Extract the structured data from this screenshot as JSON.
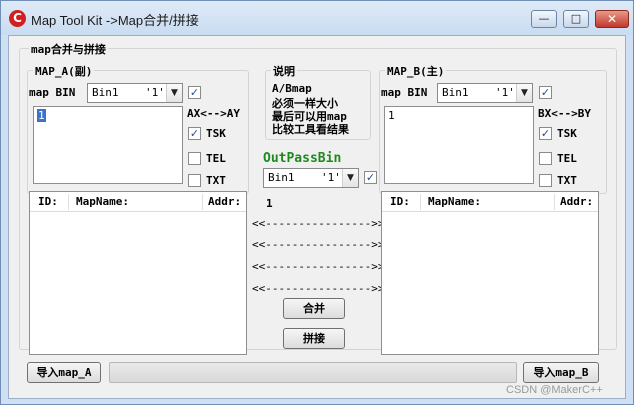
{
  "window": {
    "title": "Map Tool Kit ->Map合并/拼接",
    "app_icon": "C",
    "min_label": "—",
    "max_label": "□",
    "close_label": "✕"
  },
  "main_group": {
    "label": "map合并与拼接"
  },
  "panel_a": {
    "label": "MAP_A(副)",
    "bin_label": "map BIN",
    "combo_value": "Bin1    '1'",
    "input_value": "1",
    "axis_label": "AX<-->AY",
    "tsk_label": "TSK",
    "tel_label": "TEL",
    "txt_label": "TXT",
    "columns": [
      "ID:",
      "MapName:",
      "Addr:"
    ],
    "import_button": "导入map_A"
  },
  "middle": {
    "title": "说明",
    "notes": [
      "A/Bmap",
      "必须一样大小",
      "最后可以用map",
      "比较工具看结果"
    ],
    "outpass_label": "OutPassBin",
    "combo_value": "Bin1    '1'",
    "value": "1",
    "arrows": [
      "<<---------------->>",
      "<<---------------->>",
      "<<---------------->>",
      "<<---------------->>"
    ],
    "merge_button": "合并",
    "splice_button": "拼接"
  },
  "panel_b": {
    "label": "MAP_B(主)",
    "bin_label": "map BIN",
    "combo_value": "Bin1    '1'",
    "input_value": "1",
    "axis_label": "BX<-->BY",
    "tsk_label": "TSK",
    "tel_label": "TEL",
    "txt_label": "TXT",
    "columns": [
      "ID:",
      "MapName:",
      "Addr:"
    ],
    "import_button": "导入map_B"
  },
  "watermark": "CSDN @MakerC++"
}
